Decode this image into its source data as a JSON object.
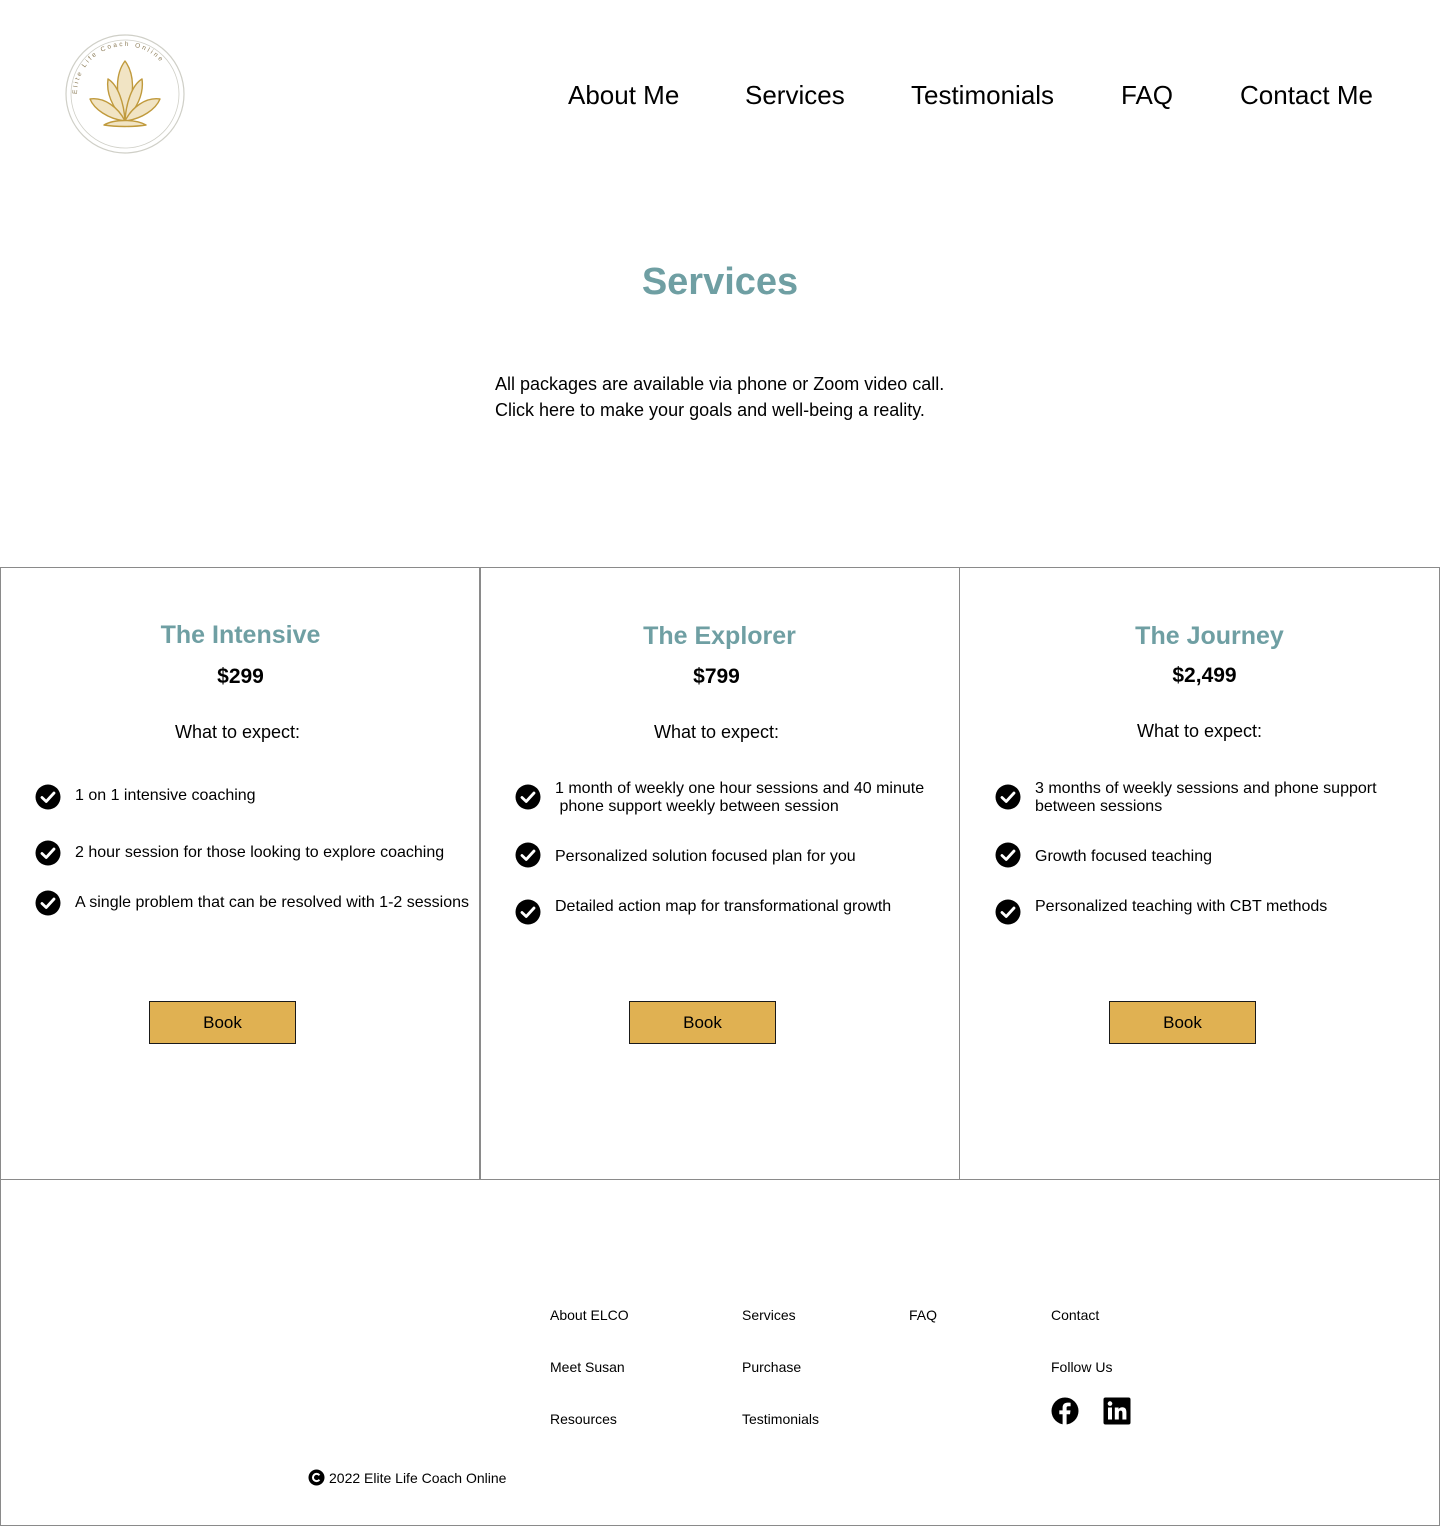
{
  "header": {
    "logo_text": "Elite Life Coach Online",
    "logo_color": "#c09a3c",
    "nav": [
      {
        "label": "About Me"
      },
      {
        "label": "Services"
      },
      {
        "label": "Testimonials"
      },
      {
        "label": "FAQ"
      },
      {
        "label": "Contact Me"
      }
    ]
  },
  "main": {
    "title": "Services",
    "title_color": "#6f9fa3",
    "intro_line1": "All packages are available via phone or Zoom video call.",
    "intro_line2": "Click here to make your goals and well-being a reality."
  },
  "packages": [
    {
      "name": "The Intensive",
      "price": "$299",
      "expect_label": "What to expect:",
      "features": [
        {
          "line1": "1 on 1 intensive coaching",
          "line2": ""
        },
        {
          "line1": "2 hour session for those looking to explore coaching",
          "line2": ""
        },
        {
          "line1": "A single problem that can be resolved with 1-2 sessions",
          "line2": ""
        }
      ],
      "button_label": "Book"
    },
    {
      "name": "The Explorer",
      "price": "$799",
      "expect_label": "What to expect:",
      "features": [
        {
          "line1": "1 month of weekly one hour sessions and 40 minute",
          "line2": " phone support weekly between session"
        },
        {
          "line1": "Personalized solution focused plan for you",
          "line2": ""
        },
        {
          "line1": "Detailed action map for transformational growth",
          "line2": ""
        }
      ],
      "button_label": "Book"
    },
    {
      "name": "The Journey",
      "price": "$2,499",
      "expect_label": "What to expect:",
      "features": [
        {
          "line1": "3 months of weekly sessions and phone support",
          "line2": "between sessions"
        },
        {
          "line1": "Growth focused teaching",
          "line2": ""
        },
        {
          "line1": "Personalized teaching with CBT methods",
          "line2": ""
        }
      ],
      "button_label": "Book"
    }
  ],
  "footer": {
    "links": {
      "about_elco": "About ELCO",
      "meet_susan": "Meet Susan",
      "resources": "Resources",
      "services": "Services",
      "purchase": "Purchase",
      "testimonials": "Testimonials",
      "faq": "FAQ",
      "contact": "Contact",
      "follow_us": "Follow Us"
    },
    "social_icons": [
      "facebook-icon",
      "linkedin-icon"
    ],
    "copyright": "2022 Elite Life Coach Online"
  },
  "colors": {
    "accent_teal": "#6f9fa3",
    "button_gold": "#e0b152",
    "logo_gold": "#c09a3c"
  }
}
